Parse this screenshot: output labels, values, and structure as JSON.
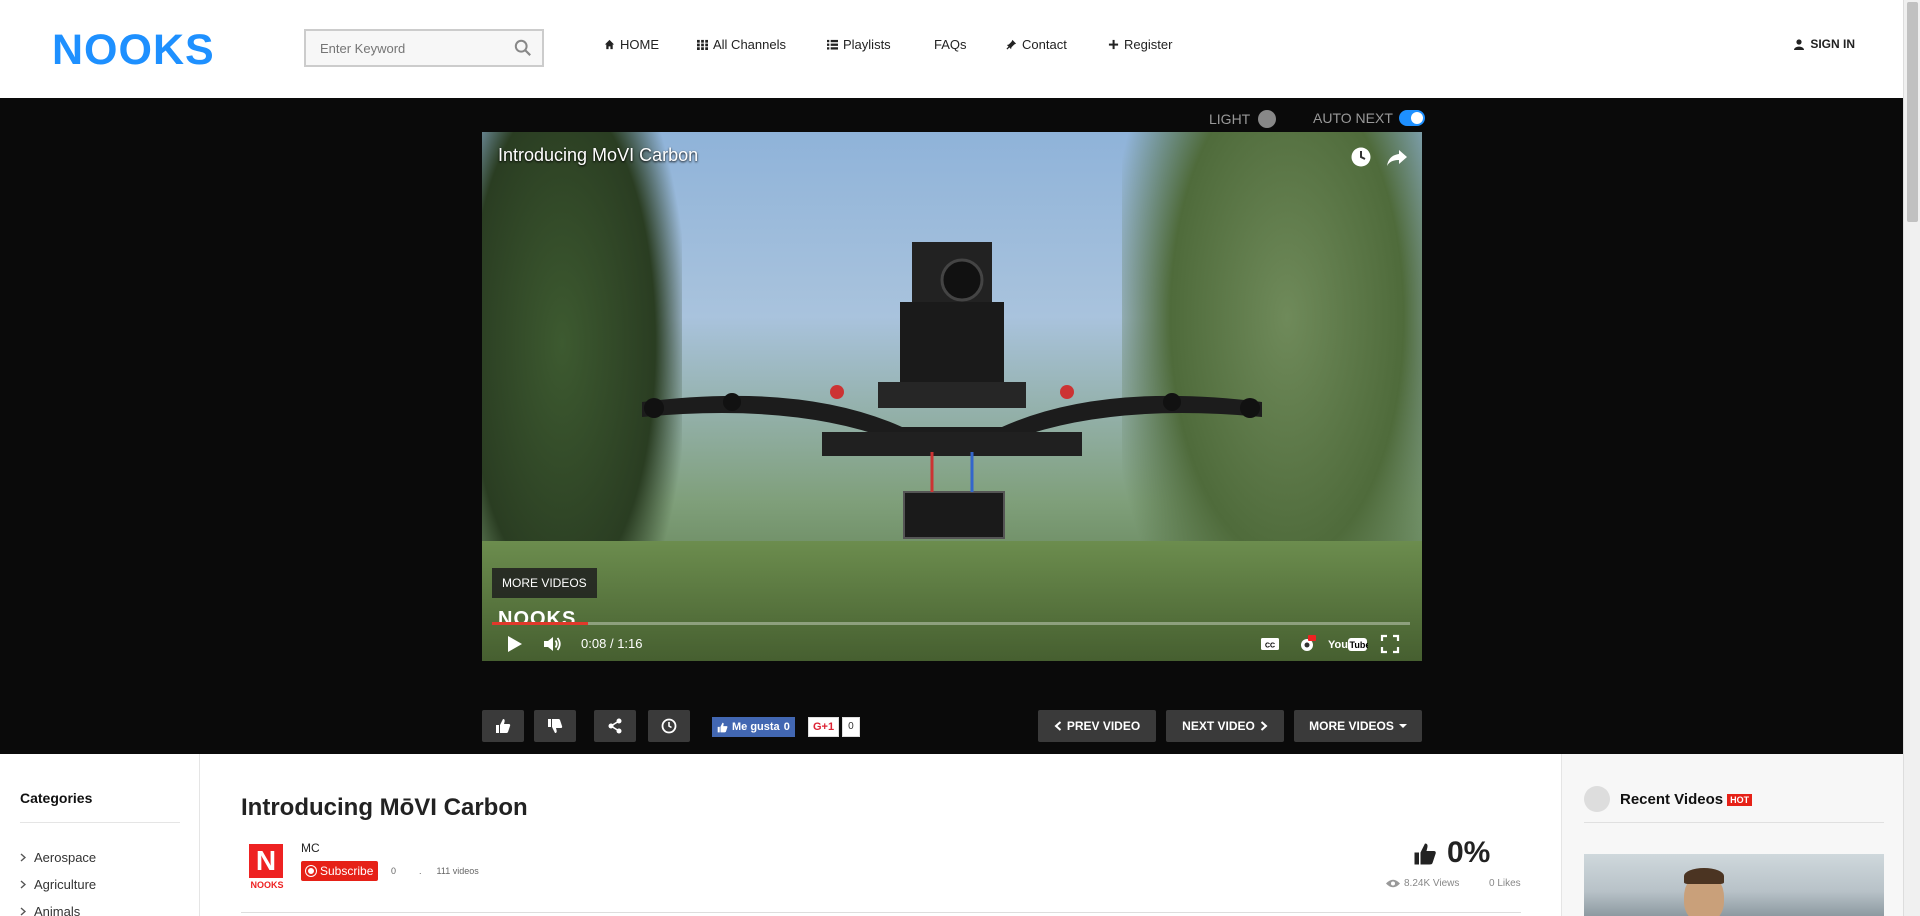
{
  "header": {
    "logo": "NOOKS",
    "search_placeholder": "Enter Keyword",
    "nav": [
      {
        "label": "HOME",
        "icon": "home-icon"
      },
      {
        "label": "All Channels",
        "icon": "grid-icon"
      },
      {
        "label": "Playlists",
        "icon": "list-icon"
      },
      {
        "label": "FAQs",
        "icon": ""
      },
      {
        "label": "Contact",
        "icon": "pin-icon"
      },
      {
        "label": "Register",
        "icon": "plus-icon"
      }
    ],
    "signin": "SIGN IN"
  },
  "player": {
    "light_label": "LIGHT",
    "autonext_label": "AUTO NEXT",
    "autonext_on": true,
    "video_title": "Introducing MoVI Carbon",
    "more_videos_overlay": "MORE VIDEOS",
    "brand_overlay": "NOOKS",
    "time_current": "0:08",
    "time_sep": "/",
    "time_total": "1:16",
    "progress_fraction": 0.105
  },
  "actions": {
    "fb_label": "Me gusta",
    "fb_count": "0",
    "gplus_label": "G+1",
    "gplus_count": "0",
    "prev_label": "PREV VIDEO",
    "next_label": "NEXT VIDEO",
    "more_label": "MORE VIDEOS"
  },
  "sidebar": {
    "title": "Categories",
    "items": [
      "Aerospace",
      "Agriculture",
      "Animals"
    ]
  },
  "main": {
    "title": "Introducing MōVI Carbon",
    "channel_name": "MC",
    "channel_logo": "N",
    "channel_logo_text": "NOOKS",
    "subscribe_label": "Subscribe",
    "subscribe_count": "0",
    "dot": ".",
    "videos_count": "111 videos",
    "like_percent": "0%",
    "views": "8.24K Views",
    "likes": "0 Likes"
  },
  "rightbar": {
    "title": "Recent Videos",
    "badge": "HOT"
  },
  "colors": {
    "brand": "#1e90ff",
    "dark_bg": "#0a0a0a",
    "button_bg": "#3a3a3a",
    "subscribe_red": "#e62117",
    "progress_red": "#e0392b"
  }
}
